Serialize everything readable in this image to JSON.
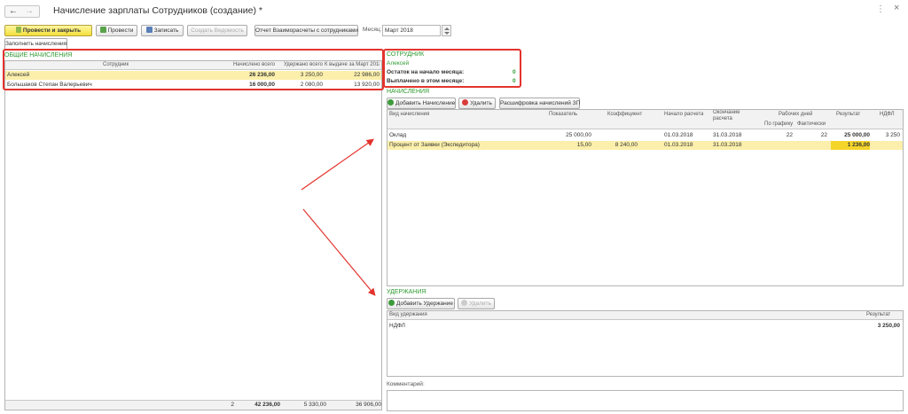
{
  "nav": {
    "back_glyph": "←",
    "forward_glyph": "→"
  },
  "window": {
    "title": "Начисление зарплаты Сотрудников (создание) *",
    "more_glyph": "⋮",
    "close_glyph": "×"
  },
  "toolbar": {
    "post_close": "Провести и закрыть",
    "post": "Провести",
    "save": "Записать",
    "create_statement": "Создать Ведомость",
    "report": "Отчет Взаиморасчеты с сотрудниками",
    "month_label": "Месяц:",
    "month_value": "Март 2018",
    "fill": "Заполнить начисления"
  },
  "general": {
    "title": "ОБЩИЕ НАЧИСЛЕНИЯ",
    "columns": [
      "Сотрудник",
      "Начислено всего",
      "Удержано всего",
      "К выдаче за Март 2018"
    ],
    "rows": [
      [
        "Алексей",
        "26 236,00",
        "3 250,00",
        "22 986,00"
      ],
      [
        "Большаков Степан Валерьевич",
        "16 000,00",
        "2 080,00",
        "13 920,00"
      ]
    ],
    "totals": [
      "2",
      "42 236,00",
      "5 330,00",
      "36 906,00"
    ]
  },
  "employee": {
    "title": "СОТРУДНИК",
    "name": "Алексей",
    "start_label": "Остаток на начало месяца:",
    "start_value": "0",
    "paid_label": "Выплачено в этом месяце:",
    "paid_value": "0"
  },
  "accruals": {
    "title": "НАЧИСЛЕНИЯ",
    "add": "Добавить Начисление",
    "delete": "Удалить",
    "decode": "Расшифровка начислений ЗП",
    "columns": {
      "type": "Вид начисления",
      "indicator": "Показатель",
      "coef": "Коэффициент",
      "start": "Начало расчета",
      "end": "Окончание расчета",
      "workdays": "Рабочих дней",
      "by_schedule": "По графику",
      "actual": "Фактически",
      "result": "Результат",
      "ndfl": "НДФЛ"
    },
    "rows": [
      [
        "Оклад",
        "25 000,00",
        "",
        "01.03.2018",
        "31.03.2018",
        "22",
        "22",
        "25 000,00",
        "3 250"
      ],
      [
        "Процент от Заявки (Экспедитора)",
        "15,00",
        "8 240,00",
        "01.03.2018",
        "31.03.2018",
        "",
        "",
        "1 236,00",
        ""
      ]
    ]
  },
  "deductions": {
    "title": "УДЕРЖАНИЯ",
    "add": "Добавить Удержание",
    "delete": "Удалить",
    "columns": [
      "Вид удержания",
      "Результат"
    ],
    "rows": [
      [
        "НДФЛ",
        "3 250,00"
      ]
    ]
  },
  "comment": {
    "label": "Комментарий:"
  },
  "colors": {
    "accent_green": "#2f9a32",
    "highlight": "#fbefab",
    "annotation_red": "#e3332d"
  }
}
